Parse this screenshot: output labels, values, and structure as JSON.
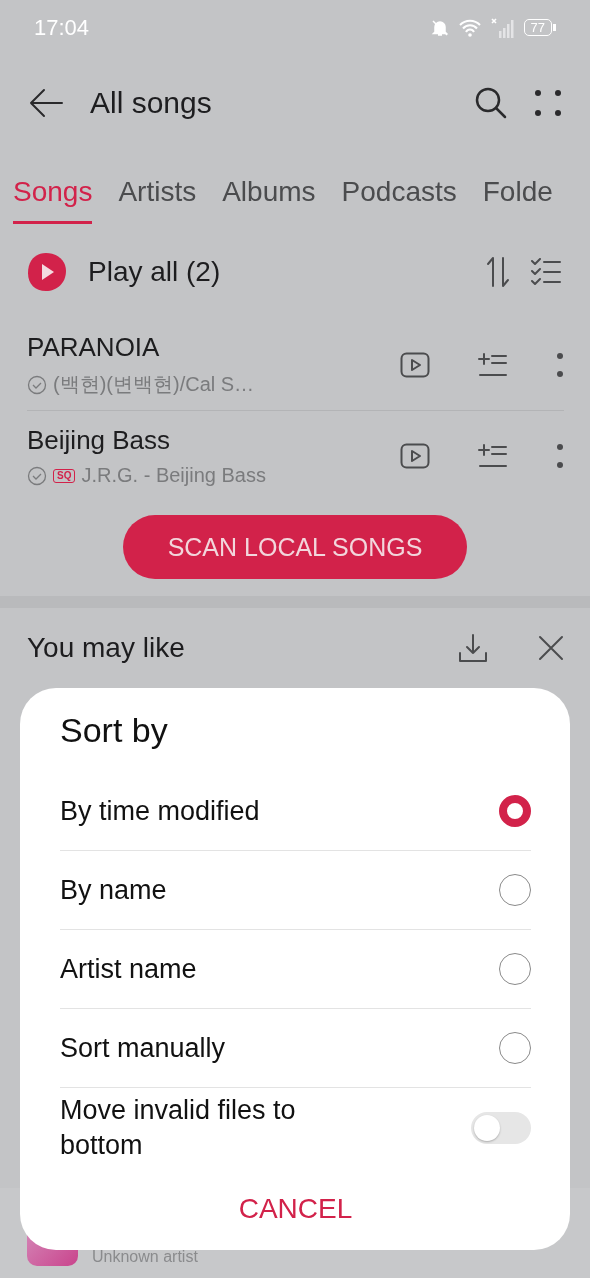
{
  "status_bar": {
    "time": "17:04",
    "battery": "77"
  },
  "header": {
    "title": "All songs"
  },
  "tabs": [
    {
      "label": "Songs",
      "selected": true
    },
    {
      "label": "Artists",
      "selected": false
    },
    {
      "label": "Albums",
      "selected": false
    },
    {
      "label": "Podcasts",
      "selected": false
    },
    {
      "label": "Folde",
      "selected": false
    }
  ],
  "play_all": {
    "label": "Play all (2)"
  },
  "songs": [
    {
      "title": "PARANOIA",
      "subtitle": "(백현)(변백현)/Cal S…"
    },
    {
      "title": "Beijing Bass",
      "badge": "SQ",
      "subtitle": "J.R.G. - Beijing Bass"
    }
  ],
  "scan_button": "SCAN LOCAL SONGS",
  "recommendations": {
    "title": "You may like"
  },
  "mini_player": {
    "artist": "Unknown artist"
  },
  "dialog": {
    "title": "Sort by",
    "options": [
      {
        "label": "By time modified",
        "selected": true
      },
      {
        "label": "By name",
        "selected": false
      },
      {
        "label": "Artist name",
        "selected": false
      },
      {
        "label": "Sort manually",
        "selected": false
      }
    ],
    "toggle": {
      "label": "Move invalid files to bottom",
      "on": false
    },
    "cancel": "CANCEL"
  }
}
